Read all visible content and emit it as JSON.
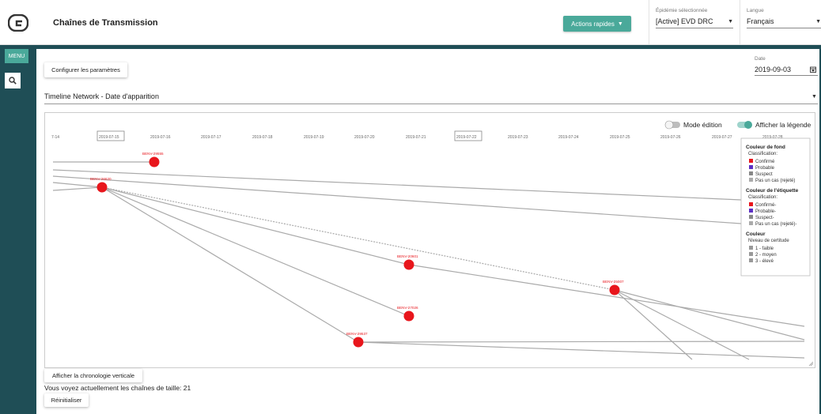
{
  "header": {
    "title": "Chaînes de Transmission",
    "actions_label": "Actions rapides",
    "epidemic": {
      "label": "Épidémie sélectionnée",
      "value": "[Active] EVD DRC"
    },
    "language": {
      "label": "Langue",
      "value": "Français"
    }
  },
  "sidebar": {
    "menu_label": "MENU",
    "search_icon": "search-icon"
  },
  "toolbar": {
    "configure_label": "Configurer les paramètres",
    "date_label": "Date",
    "date_value": "2019-09-03"
  },
  "view_select": {
    "value": "Timeline Network - Date d'apparition"
  },
  "network": {
    "edit_mode_label": "Mode édition",
    "edit_mode_on": false,
    "show_legend_label": "Afficher la légende",
    "show_legend_on": true,
    "timeline_dates": [
      "7-14",
      "2019-07-15",
      "2019-07-16",
      "2019-07-17",
      "2019-07-18",
      "2019-07-19",
      "2019-07-20",
      "2019-07-21",
      "2019-07-22",
      "2019-07-23",
      "2019-07-24",
      "2019-07-25",
      "2019-07-26",
      "2019-07-27",
      "2019-07-28"
    ],
    "highlighted_dates": [
      "2019-07-15",
      "2019-07-22"
    ],
    "nodes": [
      {
        "id": "BENV-29555"
      },
      {
        "id": "BENV-26620"
      },
      {
        "id": "BENV-20601"
      },
      {
        "id": "BENV-27026"
      },
      {
        "id": "BENV-29537"
      },
      {
        "id": "BENV-25007"
      }
    ],
    "node_color": "#e8161c",
    "edge_color": "#aaaaaa"
  },
  "legend": {
    "sections": [
      {
        "title": "Couleur de fond",
        "subtitle": "Classification:",
        "items": [
          {
            "label": "Confirmé",
            "color": "#e8161c"
          },
          {
            "label": "Probable",
            "color": "#5b2fc4"
          },
          {
            "label": "Suspect",
            "color": "#888888"
          },
          {
            "label": "Pas un cas (rejeté)",
            "color": "#aaaaaa"
          }
        ]
      },
      {
        "title": "Couleur de l'étiquette",
        "subtitle": "Classification:",
        "items": [
          {
            "label": "Confirmé-",
            "color": "#e8161c"
          },
          {
            "label": "Probable-",
            "color": "#5b2fc4"
          },
          {
            "label": "Suspect-",
            "color": "#888888"
          },
          {
            "label": "Pas un cas (rejeté)-",
            "color": "#aaaaaa"
          }
        ]
      },
      {
        "title": "Couleur",
        "subtitle": "Niveau de certitude",
        "items": [
          {
            "label": "1 - faible",
            "color": "#999999"
          },
          {
            "label": "2 - moyen",
            "color": "#999999"
          },
          {
            "label": "3 - élevé",
            "color": "#999999"
          }
        ]
      }
    ]
  },
  "footer": {
    "vertical_label": "Afficher la chronologie verticale",
    "info_text": "Vous voyez actuellement les chaînes de taille: 21",
    "reset_label": "Réinitialiser"
  }
}
